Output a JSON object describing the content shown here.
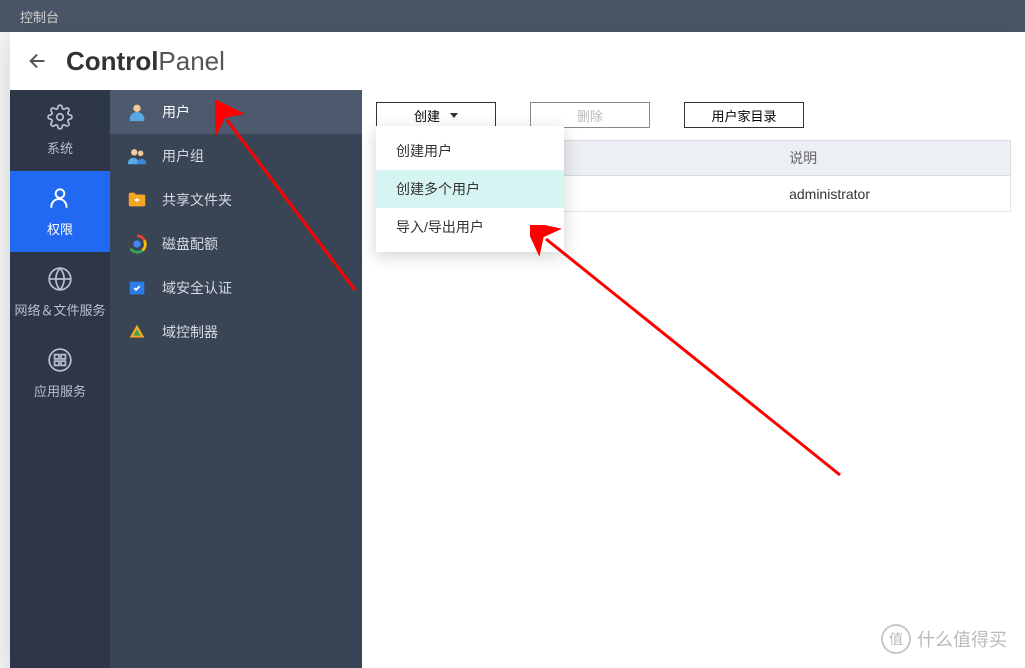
{
  "topbar": {
    "title": "控制台"
  },
  "window": {
    "title_bold": "Control",
    "title_light": "Panel"
  },
  "iconSidebar": [
    {
      "label": "系统",
      "icon": "gear"
    },
    {
      "label": "权限",
      "icon": "user",
      "active": true
    },
    {
      "label": "网络＆文件服务",
      "icon": "globe"
    },
    {
      "label": "应用服务",
      "icon": "apps"
    }
  ],
  "menuSidebar": [
    {
      "label": "用户",
      "icon": "person-blue",
      "active": true
    },
    {
      "label": "用户组",
      "icon": "group-blue"
    },
    {
      "label": "共享文件夹",
      "icon": "folder-orange"
    },
    {
      "label": "磁盘配额",
      "icon": "chrome"
    },
    {
      "label": "域安全认证",
      "icon": "shield-blue"
    },
    {
      "label": "域控制器",
      "icon": "triangle-orange"
    }
  ],
  "toolbar": {
    "create": "创建",
    "delete": "删除",
    "userhome": "用户家目录"
  },
  "dropdown": [
    {
      "label": "创建用户"
    },
    {
      "label": "创建多个用户",
      "highlight": true
    },
    {
      "label": "导入/导出用户"
    }
  ],
  "table": {
    "headers": {
      "user": "",
      "desc": "说明"
    },
    "rows": [
      {
        "user": "",
        "desc": "administrator"
      }
    ]
  },
  "watermark": {
    "symbol": "值",
    "text": "什么值得买"
  }
}
